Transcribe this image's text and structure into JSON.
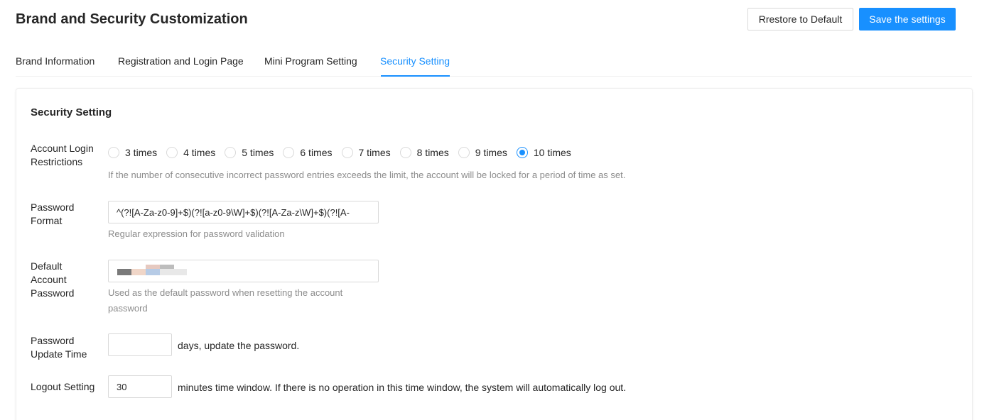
{
  "header": {
    "title": "Brand and Security Customization",
    "restore_label": "Rrestore to Default",
    "save_label": "Save the settings"
  },
  "tabs": [
    {
      "label": "Brand Information",
      "active": false
    },
    {
      "label": "Registration and Login Page",
      "active": false
    },
    {
      "label": "Mini Program Setting",
      "active": false
    },
    {
      "label": "Security Setting",
      "active": true
    }
  ],
  "section": {
    "title": "Security Setting",
    "login_restriction": {
      "label_line1": "Account Login",
      "label_line2": "Restrictions",
      "options": [
        "3 times",
        "4 times",
        "5 times",
        "6 times",
        "7 times",
        "8 times",
        "9 times",
        "10 times"
      ],
      "selected": "10 times",
      "help": "If the number of consecutive incorrect password entries exceeds the limit, the account will be locked for a period of time as set."
    },
    "password_format": {
      "label_line1": "Password",
      "label_line2": "Format",
      "value": "^(?![A-Za-z0-9]+$)(?![a-z0-9\\W]+$)(?![A-Za-z\\W]+$)(?![A-",
      "help": "Regular expression for password validation"
    },
    "default_password": {
      "label_line1": "Default",
      "label_line2": "Account",
      "label_line3": "Password",
      "help_line1": "Used as the default password when resetting the account",
      "help_line2": "password"
    },
    "update_time": {
      "label_line1": "Password",
      "label_line2": "Update Time",
      "value": "",
      "suffix": "days, update the password."
    },
    "logout": {
      "label": "Logout Setting",
      "value": "30",
      "suffix": "minutes time window. If there is no operation in this time window, the system will automatically log out."
    }
  },
  "colors": {
    "accent": "#1890ff",
    "text": "#262626",
    "muted": "#8c8c8c",
    "border": "#d9d9d9"
  }
}
